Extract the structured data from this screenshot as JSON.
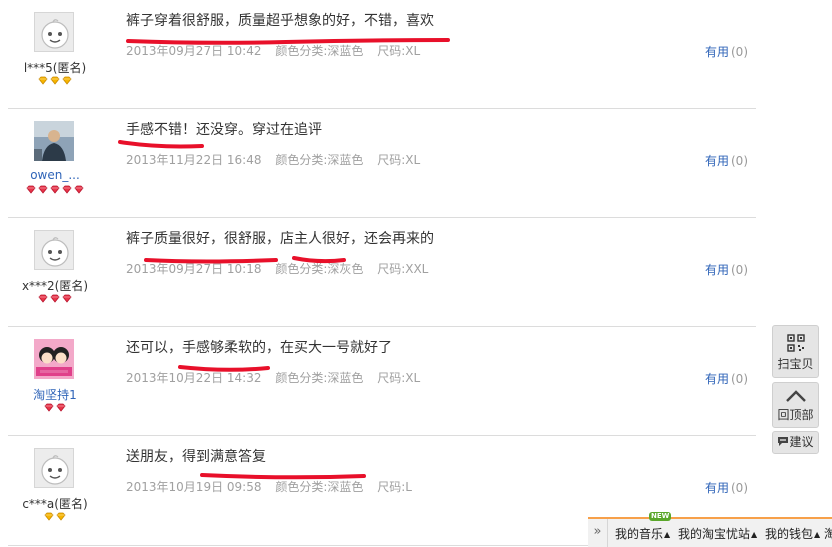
{
  "reviews": [
    {
      "user": "l***5(匿名)",
      "user_link": false,
      "avatar": "default",
      "badges": {
        "kind": "gold",
        "count": 3
      },
      "text": [
        "裤子穿着很舒服，质量超乎想象的好，不错，喜欢"
      ],
      "date": "2013年09月27日 10:42",
      "color": "颜色分类:深蓝色",
      "size": "尺码:XL",
      "helpful_label": "有用",
      "helpful_count": "(0)"
    },
    {
      "user": "owen_...",
      "user_link": true,
      "avatar": "photo",
      "badges": {
        "kind": "red",
        "count": 5
      },
      "text": [
        "手感不错！还没穿。穿过在追评"
      ],
      "date": "2013年11月22日 16:48",
      "color": "颜色分类:深蓝色",
      "size": "尺码:XL",
      "helpful_label": "有用",
      "helpful_count": "(0)"
    },
    {
      "user": "x***2(匿名)",
      "user_link": false,
      "avatar": "default",
      "badges": {
        "kind": "red",
        "count": 3
      },
      "text": [
        "裤子质量很好，很舒服，店主人很好，还会再来的"
      ],
      "date": "2013年09月27日 10:18",
      "color": "颜色分类:深灰色",
      "size": "尺码:XXL",
      "helpful_label": "有用",
      "helpful_count": "(0)"
    },
    {
      "user": "淘坚持1",
      "user_link": true,
      "avatar": "cartoon",
      "badges": {
        "kind": "red",
        "count": 2
      },
      "text": [
        "还可以，手感够柔软的，在买大一号就好了"
      ],
      "date": "2013年10月22日 14:32",
      "color": "颜色分类:深蓝色",
      "size": "尺码:XL",
      "helpful_label": "有用",
      "helpful_count": "(0)"
    },
    {
      "user": "c***a(匿名)",
      "user_link": false,
      "avatar": "default",
      "badges": {
        "kind": "gold",
        "count": 2
      },
      "text": [
        "送朋友，得到满意答复"
      ],
      "date": "2013年10月19日 09:58",
      "color": "颜色分类:深蓝色",
      "size": "尺码:L",
      "helpful_label": "有用",
      "helpful_count": "(0)"
    }
  ],
  "sidebar": {
    "scan_label": "扫宝贝",
    "top_label": "回顶部",
    "suggest_label": "建议"
  },
  "bottom_bar": {
    "new_badge": "NEW",
    "items": [
      "我的音乐",
      "我的淘宝忧站",
      "我的钱包",
      "淘"
    ]
  },
  "colors": {
    "link": "#2f64b8",
    "annotation_ink": "#e8102a",
    "bottom_bar_accent": "#f7a04a"
  }
}
